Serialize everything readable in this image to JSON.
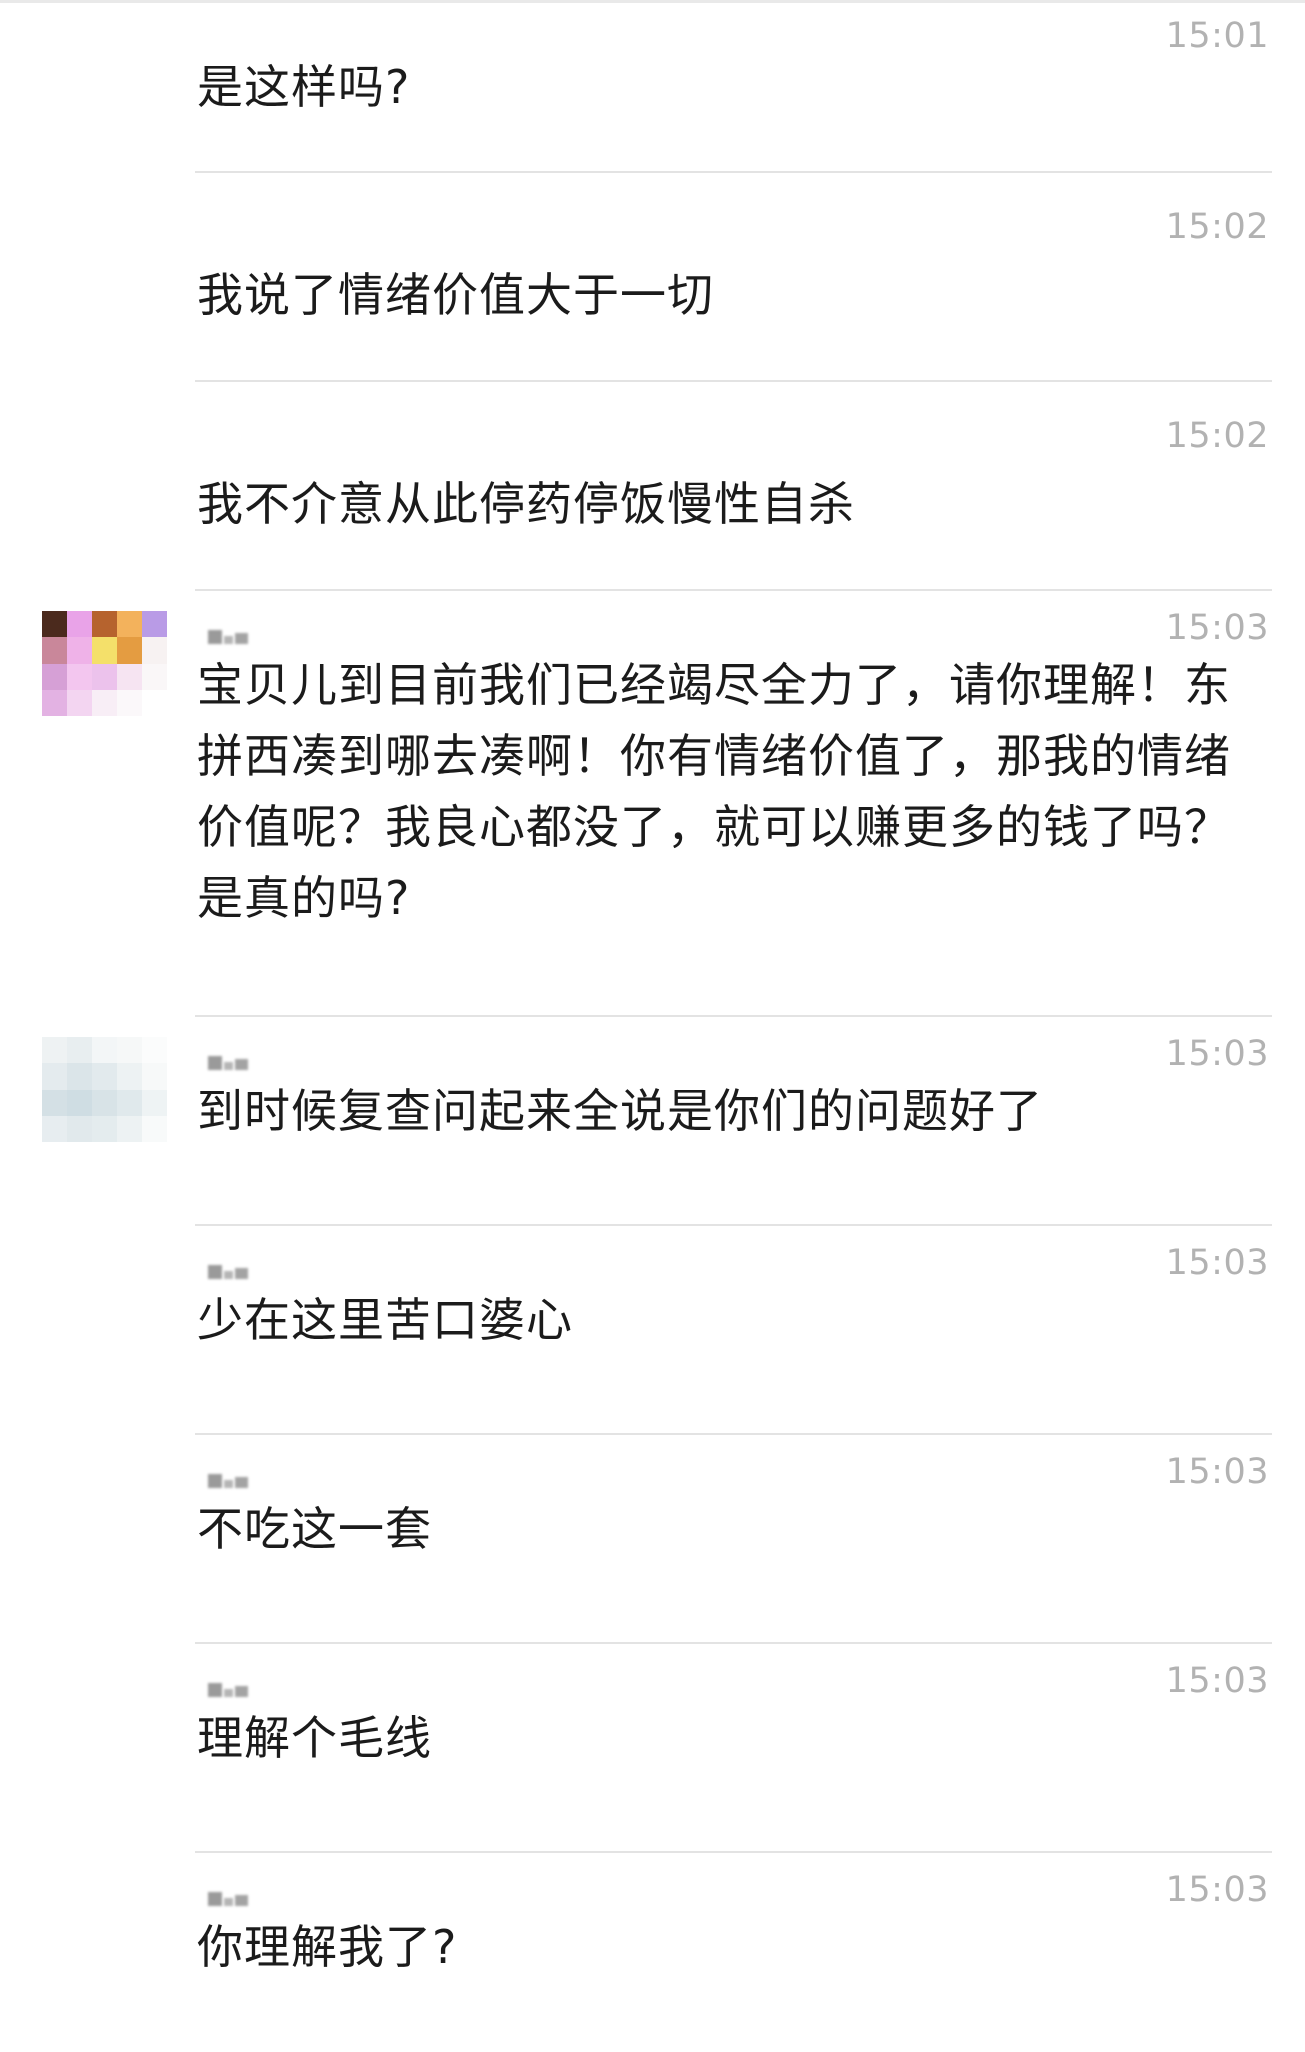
{
  "messages": [
    {
      "time": "15:01",
      "text": "是这样吗?",
      "show_avatar": false,
      "show_sender": false
    },
    {
      "time": "15:02",
      "text": "我说了情绪价值大于一切",
      "show_avatar": false,
      "show_sender": false
    },
    {
      "time": "15:02",
      "text": "我不介意从此停药停饭慢性自杀",
      "show_avatar": false,
      "show_sender": false
    },
    {
      "time": "15:03",
      "text": "宝贝儿到目前我们已经竭尽全力了，请你理解！东拼西凑到哪去凑啊！你有情绪价值了，那我的情绪价值呢？我良心都没了，就可以赚更多的钱了吗？是真的吗?",
      "show_avatar": true,
      "avatar_style": "colorful",
      "show_sender": true
    },
    {
      "time": "15:03",
      "text": "到时候复查问起来全说是你们的问题好了",
      "show_avatar": true,
      "avatar_style": "pale",
      "show_sender": true
    },
    {
      "time": "15:03",
      "text": "少在这里苦口婆心",
      "show_avatar": false,
      "show_sender": true
    },
    {
      "time": "15:03",
      "text": "不吃这一套",
      "show_avatar": false,
      "show_sender": true
    },
    {
      "time": "15:03",
      "text": "理解个毛线",
      "show_avatar": false,
      "show_sender": true
    },
    {
      "time": "15:03",
      "text": "你理解我了?",
      "show_avatar": false,
      "show_sender": true
    }
  ],
  "avatars": {
    "colorful": [
      "#4b2a1d",
      "#e9a3e8",
      "#b6632e",
      "#f3b25c",
      "#b99be6",
      "#c9879a",
      "#efb2e8",
      "#f4e06a",
      "#e49c41",
      "#f7f2f2",
      "#d6a0d6",
      "#f3c6ef",
      "#ecc2ec",
      "#f6e4f2",
      "#faf7f8",
      "#e3b2e3",
      "#f3d5f1",
      "#f8eef6",
      "#fbf8fa",
      "#ffffff"
    ],
    "pale": [
      "#eef2f3",
      "#e8eef0",
      "#f3f6f7",
      "#f6f8f8",
      "#fbfcfc",
      "#e4ebee",
      "#dbe5e9",
      "#e2eaed",
      "#edf2f3",
      "#f7f9f9",
      "#d4e0e5",
      "#cfdde3",
      "#d8e3e7",
      "#e0e9ec",
      "#eef3f4",
      "#e7edf0",
      "#e1e9ec",
      "#e4ecee",
      "#edf2f3",
      "#f8fafa"
    ]
  },
  "colors": {
    "text": "#1b1b1b",
    "time": "#b2b2b2",
    "divider": "#e3e3e3",
    "sender_blur": "#8a8a8a"
  }
}
